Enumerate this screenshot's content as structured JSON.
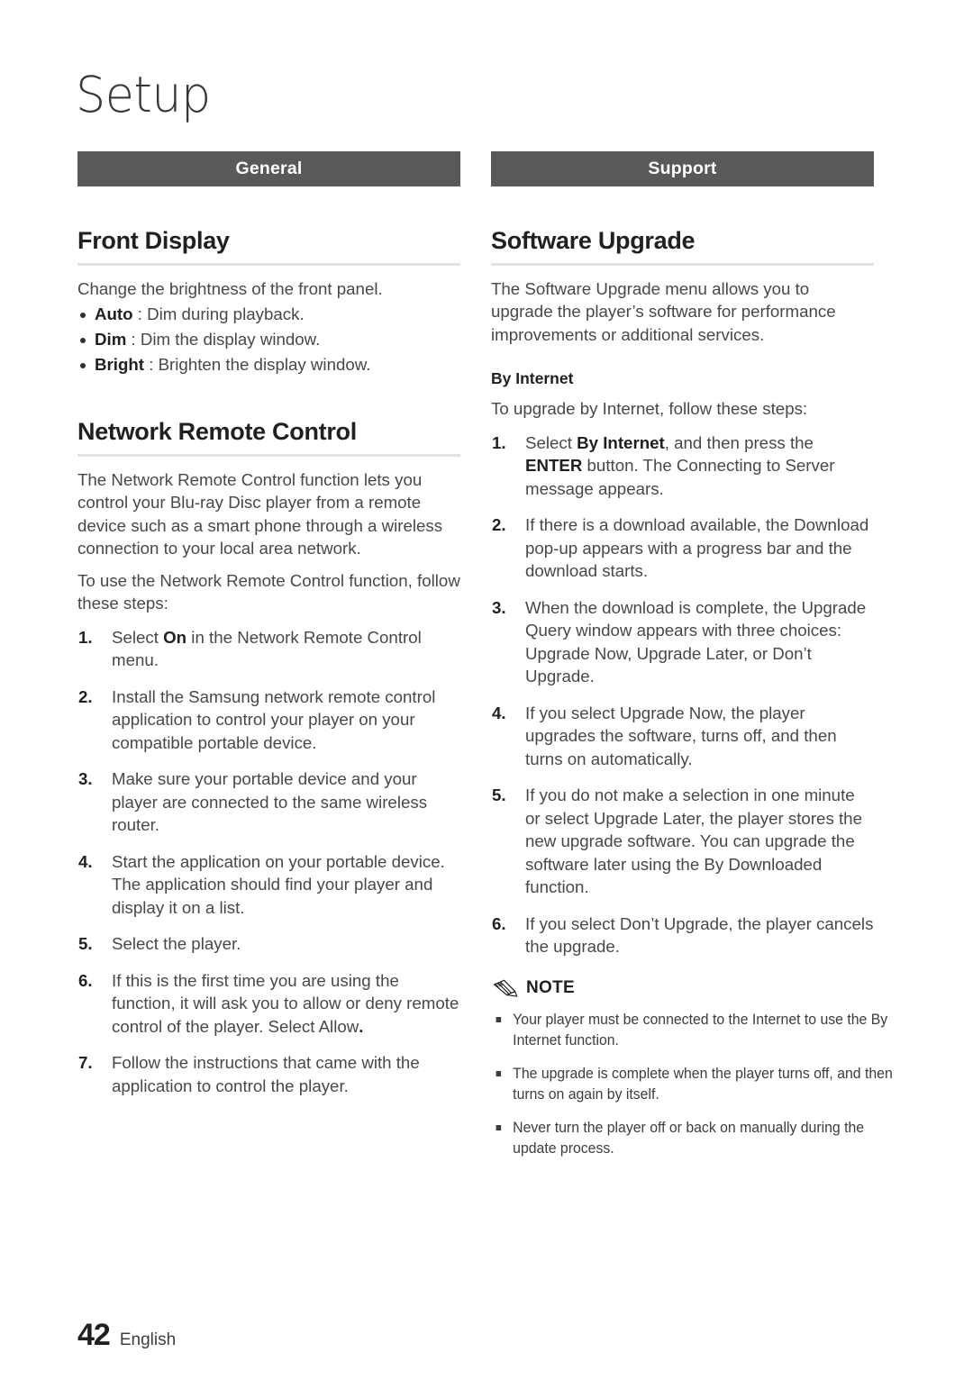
{
  "page": {
    "chapter_title": "Setup",
    "footer": {
      "page_number": "42",
      "language": "English"
    },
    "colors": {
      "banner_background": "#5a595a",
      "banner_text": "#ffffff",
      "heading_rule": "#e2e2e4",
      "body_text": "#4a4749",
      "heading_text": "#231f20"
    }
  },
  "left_column": {
    "banner": "General",
    "sections": [
      {
        "heading": "Front Display",
        "intro": "Change the brightness of the front panel.",
        "bullets": [
          {
            "term": "Auto",
            "sep": " : ",
            "text": "Dim during playback."
          },
          {
            "term": "Dim",
            "sep": " : ",
            "text": "Dim the display window."
          },
          {
            "term": "Bright",
            "sep": " : ",
            "text": "Brighten the display window."
          }
        ]
      },
      {
        "heading": "Network Remote Control",
        "paragraphs": [
          "The Network Remote Control function lets you control your Blu-ray Disc player from a remote device such as a smart phone through a wireless connection to your local area network.",
          "To use the Network Remote Control function, follow these steps:"
        ],
        "steps": [
          {
            "num": "1.",
            "pre": "Select ",
            "bold": "On",
            "post": " in the Network Remote Control menu."
          },
          {
            "num": "2.",
            "pre": "Install the Samsung network remote control application to control your player on your compatible portable device.",
            "bold": "",
            "post": ""
          },
          {
            "num": "3.",
            "pre": "Make sure your portable device and your player are connected to the same wireless router.",
            "bold": "",
            "post": ""
          },
          {
            "num": "4.",
            "pre": "Start the application on your portable device. The application should find your player and display it on a list.",
            "bold": "",
            "post": ""
          },
          {
            "num": "5.",
            "pre": "Select the player.",
            "bold": "",
            "post": ""
          },
          {
            "num": "6.",
            "pre": "If this is the first time you are using the function, it will ask you to allow or deny remote control of the player. Select Allow",
            "bold": ".",
            "post": ""
          },
          {
            "num": "7.",
            "pre": "Follow the instructions that came with the application to control the player.",
            "bold": "",
            "post": ""
          }
        ]
      }
    ]
  },
  "right_column": {
    "banner": "Support",
    "sections": [
      {
        "heading": "Software Upgrade",
        "intro": "The Software Upgrade menu allows you to upgrade the player’s software for performance improvements or additional services.",
        "subheading": "By Internet",
        "sub_intro": "To upgrade by Internet, follow these steps:",
        "steps": [
          {
            "num": "1.",
            "pre": "Select ",
            "bold": "By Internet",
            "mid": ", and then press the ",
            "bold2": "ENTER",
            "post": " button. The Connecting to Server message appears."
          },
          {
            "num": "2.",
            "pre": "If there is a download available, the Download pop-up appears with a progress bar and the download starts.",
            "bold": "",
            "mid": "",
            "bold2": "",
            "post": ""
          },
          {
            "num": "3.",
            "pre": "When the download is complete, the Upgrade Query window appears with three choices: Upgrade Now, Upgrade Later, or Don’t Upgrade.",
            "bold": "",
            "mid": "",
            "bold2": "",
            "post": ""
          },
          {
            "num": "4.",
            "pre": "If you select Upgrade Now, the player upgrades the software, turns off, and then turns on automatically.",
            "bold": "",
            "mid": "",
            "bold2": "",
            "post": ""
          },
          {
            "num": "5.",
            "pre": "If you do not make a selection in one minute or select Upgrade Later, the player stores the new upgrade software. You can upgrade the software later using the By Downloaded function.",
            "bold": "",
            "mid": "",
            "bold2": "",
            "post": ""
          },
          {
            "num": "6.",
            "pre": "If you select Don’t Upgrade, the player cancels the upgrade.",
            "bold": "",
            "mid": "",
            "bold2": "",
            "post": ""
          }
        ]
      }
    ],
    "note": {
      "icon": "pencil-icon",
      "label": "NOTE",
      "items": [
        "Your player must be connected to the Internet to use the By Internet function.",
        "The upgrade is complete when the player turns off, and then turns on again by itself.",
        "Never turn the player off or back on manually during the update process."
      ]
    }
  }
}
